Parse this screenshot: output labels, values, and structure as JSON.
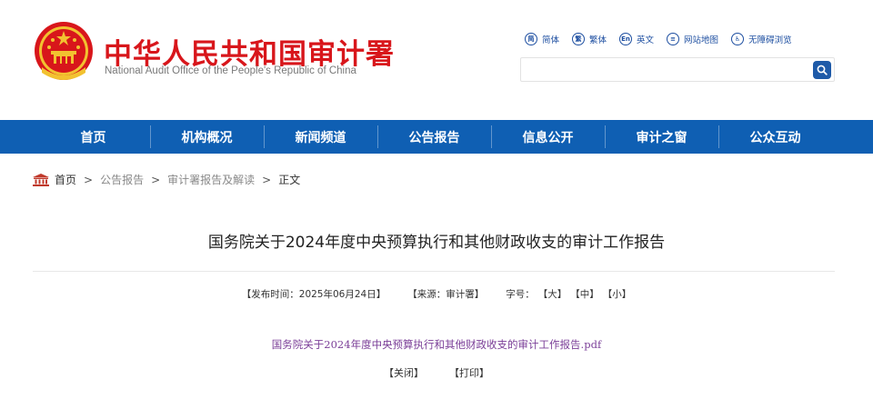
{
  "header": {
    "title": "中华人民共和国审计署",
    "subtitle": "National Audit Office of the People's Republic of China",
    "toplinks": [
      {
        "icon": "simplified-chinese-icon",
        "glyph": "简",
        "label": "简体"
      },
      {
        "icon": "traditional-chinese-icon",
        "glyph": "繁",
        "label": "繁体"
      },
      {
        "icon": "english-icon",
        "glyph": "En",
        "label": "英文"
      },
      {
        "icon": "sitemap-icon",
        "glyph": "≡",
        "label": "网站地图"
      },
      {
        "icon": "accessibility-icon",
        "glyph": "♿",
        "label": "无障碍浏览"
      }
    ],
    "search": {
      "placeholder": ""
    }
  },
  "nav": {
    "items": [
      "首页",
      "机构概况",
      "新闻频道",
      "公告报告",
      "信息公开",
      "审计之窗",
      "公众互动"
    ]
  },
  "breadcrumb": {
    "home": "首页",
    "sep": ">",
    "items": [
      "公告报告",
      "审计署报告及解读",
      "正文"
    ]
  },
  "article": {
    "title": "国务院关于2024年度中央预算执行和其他财政收支的审计工作报告",
    "publish_time": "【发布时间：2025年06月24日】",
    "source": "【来源：审计署】",
    "font_size_label": "字号：",
    "font_sizes": [
      "【大】",
      "【中】",
      "【小】"
    ],
    "attachment": "国务院关于2024年度中央预算执行和其他财政收支的审计工作报告.pdf",
    "close": "【关闭】",
    "print": "【打印】"
  },
  "colors": {
    "brand_red": "#d8161b",
    "nav_blue": "#0f5fb3",
    "link_blue": "#1e4fa1",
    "attachment_purple": "#7b3f98"
  }
}
